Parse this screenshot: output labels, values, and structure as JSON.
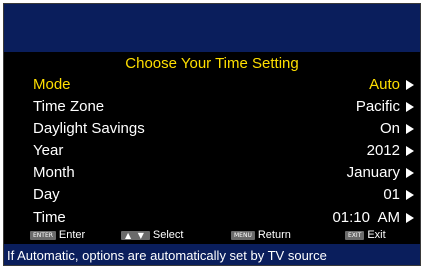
{
  "menu": {
    "title": "Choose Your Time Setting",
    "items": [
      {
        "label": "Mode",
        "value": "Auto",
        "selected": true
      },
      {
        "label": "Time Zone",
        "value": "Pacific"
      },
      {
        "label": "Daylight Savings",
        "value": "On"
      },
      {
        "label": "Year",
        "value": "2012"
      },
      {
        "label": "Month",
        "value": "January"
      },
      {
        "label": "Day",
        "value": "01"
      },
      {
        "label": "Time",
        "value": "01:10  AM"
      }
    ]
  },
  "help": {
    "enter_key": "ENTER",
    "enter_label": "Enter",
    "select_key": "▲ ▼",
    "select_label": "Select",
    "menu_key": "MENU",
    "return_label": "Return",
    "exit_key": "EXIT",
    "exit_label": "Exit"
  },
  "status": {
    "message": "If Automatic, options are automatically set by TV source"
  },
  "colors": {
    "highlight": "#ffdf00",
    "band": "#0a1e5c",
    "background": "#000000",
    "text": "#ffffff"
  },
  "icons": {
    "row_arrow": "arrow-right-icon"
  }
}
